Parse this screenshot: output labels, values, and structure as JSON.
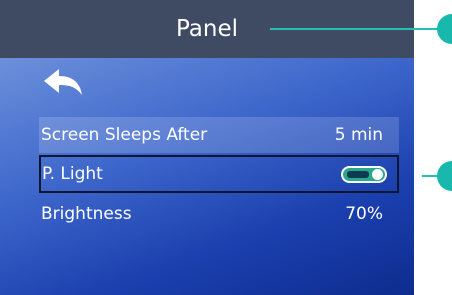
{
  "header": {
    "title": "Panel"
  },
  "nav": {
    "back_icon": "back-arrow-icon"
  },
  "settings": [
    {
      "label": "Screen Sleeps After",
      "value": "5 min"
    },
    {
      "label": "P. Light",
      "value_type": "toggle",
      "toggle_on": true
    },
    {
      "label": "Brightness",
      "value": "70%"
    }
  ],
  "colors": {
    "header_bg": "#3e4b63",
    "toggle_accent": "#2aa88d",
    "callout": "#19b8ad"
  }
}
